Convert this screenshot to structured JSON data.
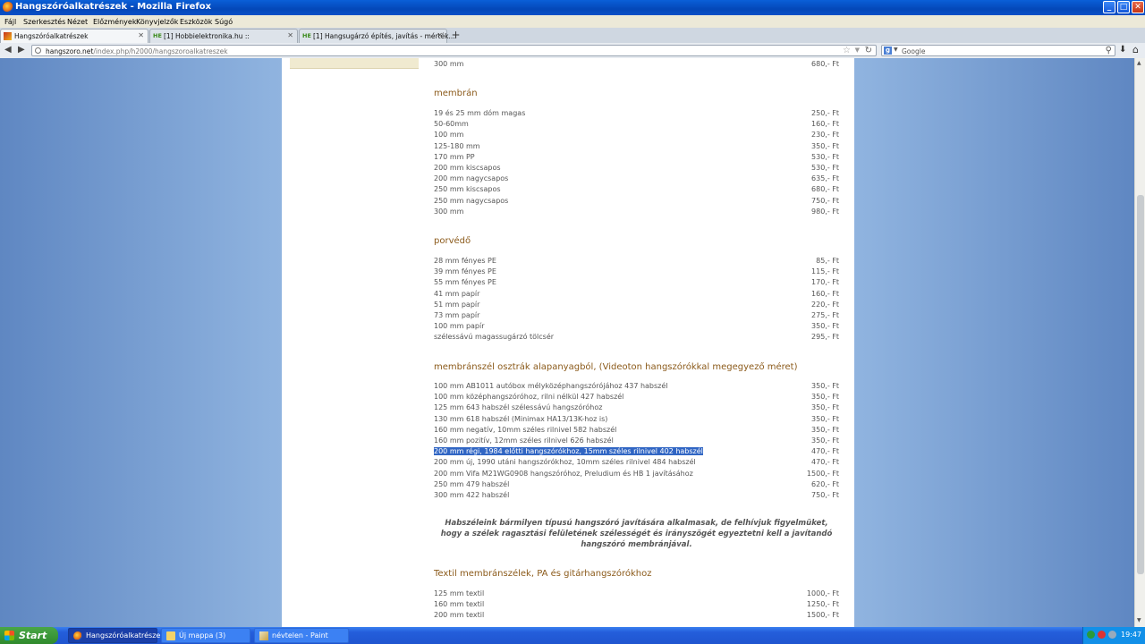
{
  "window": {
    "title": "Hangszóróalkatrészek - Mozilla Firefox",
    "buttons": [
      "_",
      "□",
      "✕"
    ]
  },
  "menu": [
    "Fájl",
    "Szerkesztés",
    "Nézet",
    "Előzmények",
    "Könyvjelzők",
    "Eszközök",
    "Súgó"
  ],
  "tabs": [
    {
      "label": "Hangszóróalkatrészek",
      "icon": "site-favicon",
      "close": "✕"
    },
    {
      "label": "[1] Hobbielektronika.hu ::",
      "icon_text": "HE",
      "close": "✕"
    },
    {
      "label": "[1] Hangsugárzó építés, javítás - mérték...",
      "icon_text": "HE",
      "close": "✕"
    }
  ],
  "new_tab": "+",
  "nav": {
    "back": "◀",
    "forward": "▶",
    "url_domain": "hangszoro.net",
    "url_path": "/index.php/h2000/hangszoroalkatreszek",
    "star": "☆",
    "reload": "↻",
    "search_placeholder": "Google",
    "search_engine_letter": "g",
    "download": "⬇",
    "home": "⌂"
  },
  "content": {
    "top_row": {
      "name": "300 mm",
      "price": "680,- Ft"
    },
    "sections": [
      {
        "heading": "membrán",
        "items": [
          {
            "name": "19 és 25 mm dóm magas",
            "price": "250,- Ft"
          },
          {
            "name": "50-60mm",
            "price": "160,- Ft"
          },
          {
            "name": "100 mm",
            "price": "230,- Ft"
          },
          {
            "name": "125-180 mm",
            "price": "350,- Ft"
          },
          {
            "name": "170 mm PP",
            "price": "530,- Ft"
          },
          {
            "name": "200 mm kiscsapos",
            "price": "530,- Ft"
          },
          {
            "name": "200 mm nagycsapos",
            "price": "635,- Ft"
          },
          {
            "name": "250 mm kiscsapos",
            "price": "680,- Ft"
          },
          {
            "name": "250 mm nagycsapos",
            "price": "750,- Ft"
          },
          {
            "name": "300 mm",
            "price": "980,- Ft"
          }
        ]
      },
      {
        "heading": "porvédő",
        "items": [
          {
            "name": "28 mm fényes PE",
            "price": "85,- Ft"
          },
          {
            "name": "39 mm fényes PE",
            "price": "115,- Ft"
          },
          {
            "name": "55 mm fényes PE",
            "price": "170,- Ft"
          },
          {
            "name": "41 mm papír",
            "price": "160,- Ft"
          },
          {
            "name": "51 mm papír",
            "price": "220,- Ft"
          },
          {
            "name": "73 mm papír",
            "price": "275,- Ft"
          },
          {
            "name": "100 mm papír",
            "price": "350,- Ft"
          },
          {
            "name": "szélessávú magassugárzó tölcsér",
            "price": "295,- Ft"
          }
        ]
      },
      {
        "heading": "membránszél osztrák alapanyagból, (Videoton hangszórókkal megegyező méret)",
        "items": [
          {
            "name": "100 mm AB1011 autóbox mélyközéphangszórójához 437 habszél",
            "price": "350,- Ft"
          },
          {
            "name": "100 mm középhangszóróhoz, rilni nélkül 427 habszél",
            "price": "350,- Ft"
          },
          {
            "name": "125 mm 643 habszél szélessávú hangszóróhoz",
            "price": "350,- Ft"
          },
          {
            "name": "130 mm 618 habszél (Minimax HA13/13K-hoz is)",
            "price": "350,- Ft"
          },
          {
            "name": "160 mm negatív, 10mm széles rilnivel 582 habszél",
            "price": "350,- Ft"
          },
          {
            "name": "160 mm pozitív, 12mm széles rilnivel 626 habszél",
            "price": "350,- Ft"
          },
          {
            "name": "200 mm régi, 1984 előtti hangszórókhoz, 15mm széles rilnivel 402 habszél",
            "price": "470,- Ft",
            "selected": true
          },
          {
            "name": "200 mm új, 1990 utáni hangszórókhoz, 10mm széles rilnivel 484 habszél",
            "price": "470,- Ft"
          },
          {
            "name": "200 mm Vifa M21WG0908 hangszóróhoz, Preludium és HB 1 javításához",
            "price": "1500,- Ft"
          },
          {
            "name": "250 mm 479 habszél",
            "price": "620,- Ft"
          },
          {
            "name": "300 mm 422 habszél",
            "price": "750,- Ft"
          }
        ]
      }
    ],
    "note_lines": [
      "Habszéleink bármilyen típusú hangszóró javítására alkalmasak, de felhívjuk figyelmüket,",
      "hogy a szélek ragasztási felületének szélességét és irányszögét egyeztetni kell a javítandó",
      "hangszóró membránjával."
    ],
    "textile": {
      "heading": "Textil membránszélek, PA és gitárhangszórókhoz",
      "items": [
        {
          "name": "125 mm textil",
          "price": "1000,- Ft"
        },
        {
          "name": "160 mm textil",
          "price": "1250,- Ft"
        },
        {
          "name": "200 mm textil",
          "price": "1500,- Ft"
        }
      ]
    }
  },
  "taskbar": {
    "start": "Start",
    "tasks": [
      "Hangszóróalkatrésze...",
      "Új mappa (3)",
      "névtelen - Paint"
    ],
    "clock": "19:47"
  },
  "colors": {
    "heading": "#8b5a1a",
    "selection": "#3166c4",
    "taskbar": "#245edb"
  }
}
